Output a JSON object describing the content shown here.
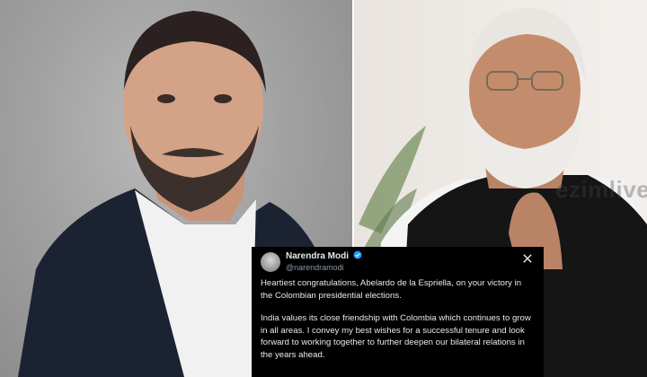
{
  "tweet": {
    "display_name": "Narendra Modi",
    "handle": "@narendramodi",
    "paragraphs": [
      "Heartiest congratulations, Abelardo de la Espriella, on your victory in the Colombian presidential elections.",
      "India values its close friendship with Colombia which continues to grow in all areas. I convey my best wishes for a successful tenure and look forward to working together to further deepen our bilateral relations in the years ahead."
    ],
    "verified_icon": "verified-badge-icon",
    "platform_icon": "x-logo-icon"
  },
  "watermark": {
    "text": "ezimlive.tv"
  },
  "colors": {
    "tweet_background": "#000000",
    "tweet_text": "#e7e9ea",
    "handle_text": "#8b98a5",
    "verified": "#1d9bf0"
  }
}
